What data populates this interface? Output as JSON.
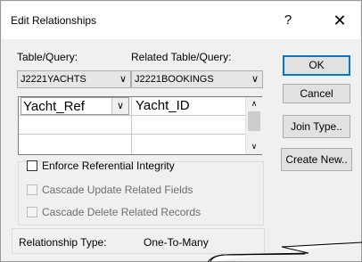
{
  "dialog": {
    "title": "Edit Relationships",
    "help_label": "?",
    "close_label": "✕"
  },
  "tables": {
    "table_label": "Table/Query:",
    "related_label": "Related Table/Query:",
    "table_value": "J2221YACHTS",
    "related_value": "J2221BOOKINGS"
  },
  "fields": {
    "rows": [
      {
        "left": "Yacht_Ref",
        "right": "Yacht_ID"
      }
    ]
  },
  "buttons": {
    "ok": "OK",
    "cancel": "Cancel",
    "join_type": "Join Type..",
    "create_new": "Create New.."
  },
  "options": {
    "enforce": "Enforce Referential Integrity",
    "cascade_update": "Cascade Update Related Fields",
    "cascade_delete": "Cascade Delete Related Records"
  },
  "relationship": {
    "label": "Relationship Type:",
    "value": "One-To-Many"
  },
  "glyphs": {
    "dropdown": "∨",
    "scroll_up": "∧",
    "scroll_down": "∨"
  }
}
